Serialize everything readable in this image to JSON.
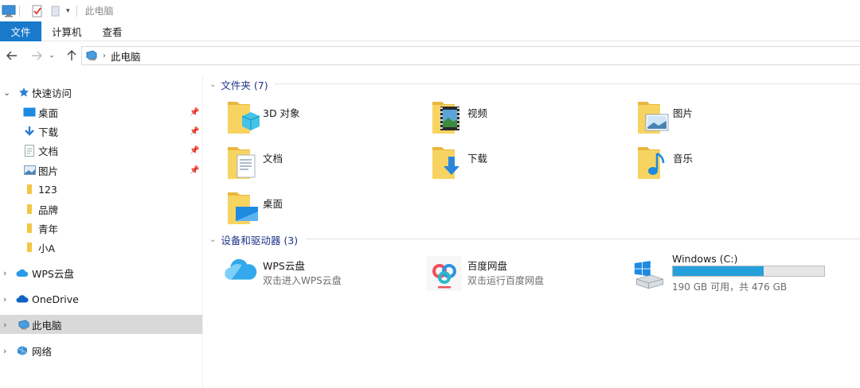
{
  "window": {
    "title": "此电脑"
  },
  "ribbon": {
    "tabs": [
      "文件",
      "计算机",
      "查看"
    ]
  },
  "address": {
    "path": "此电脑"
  },
  "sidebar": {
    "quick_access": "快速访问",
    "quick_items": [
      {
        "label": "桌面",
        "pinned": true
      },
      {
        "label": "下载",
        "pinned": true
      },
      {
        "label": "文档",
        "pinned": true
      },
      {
        "label": "图片",
        "pinned": true
      },
      {
        "label": "123",
        "pinned": false
      },
      {
        "label": "品牌",
        "pinned": false
      },
      {
        "label": "青年",
        "pinned": false
      },
      {
        "label": "小A",
        "pinned": false
      }
    ],
    "wps_cloud": "WPS云盘",
    "onedrive": "OneDrive",
    "this_pc": "此电脑",
    "network": "网络"
  },
  "folders": {
    "header": "文件夹 (7)",
    "items": [
      "3D 对象",
      "视频",
      "图片",
      "文档",
      "下载",
      "音乐",
      "桌面"
    ]
  },
  "devices": {
    "header": "设备和驱动器 (3)",
    "wps": {
      "name": "WPS云盘",
      "sub": "双击进入WPS云盘"
    },
    "baidu": {
      "name": "百度网盘",
      "sub": "双击运行百度网盘"
    },
    "drive": {
      "name": "Windows (C:)",
      "sub": "190 GB 可用，共 476 GB",
      "used_fraction": 0.6,
      "bar_color": "#26a0da"
    }
  },
  "colors": {
    "accent": "#1979ca",
    "folder": "#f5c945",
    "group_header": "#1e3287"
  }
}
